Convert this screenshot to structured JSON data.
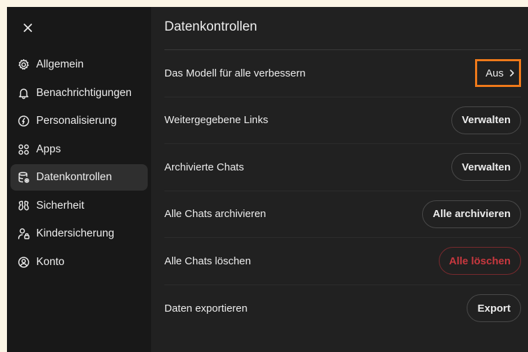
{
  "sidebar": {
    "close_icon": "close-icon",
    "items": [
      {
        "label": "Allgemein",
        "icon": "gear-icon"
      },
      {
        "label": "Benachrichtigungen",
        "icon": "bell-icon"
      },
      {
        "label": "Personalisierung",
        "icon": "personalization-icon"
      },
      {
        "label": "Apps",
        "icon": "apps-grid-icon"
      },
      {
        "label": "Datenkontrollen",
        "icon": "database-icon",
        "active": true
      },
      {
        "label": "Sicherheit",
        "icon": "shield-icon"
      },
      {
        "label": "Kindersicherung",
        "icon": "parental-control-icon"
      },
      {
        "label": "Konto",
        "icon": "account-icon"
      }
    ]
  },
  "main": {
    "title": "Datenkontrollen",
    "rows": [
      {
        "label": "Das Modell für alle verbessern",
        "action": "Aus"
      },
      {
        "label": "Weitergegebene Links",
        "action": "Verwalten"
      },
      {
        "label": "Archivierte Chats",
        "action": "Verwalten"
      },
      {
        "label": "Alle Chats archivieren",
        "action": "Alle archivieren"
      },
      {
        "label": "Alle Chats löschen",
        "action": "Alle löschen"
      },
      {
        "label": "Daten exportieren",
        "action": "Export"
      }
    ]
  },
  "colors": {
    "background": "#212121",
    "sidebar": "#181818",
    "highlight": "#f07a1a",
    "danger": "#c9383f"
  }
}
